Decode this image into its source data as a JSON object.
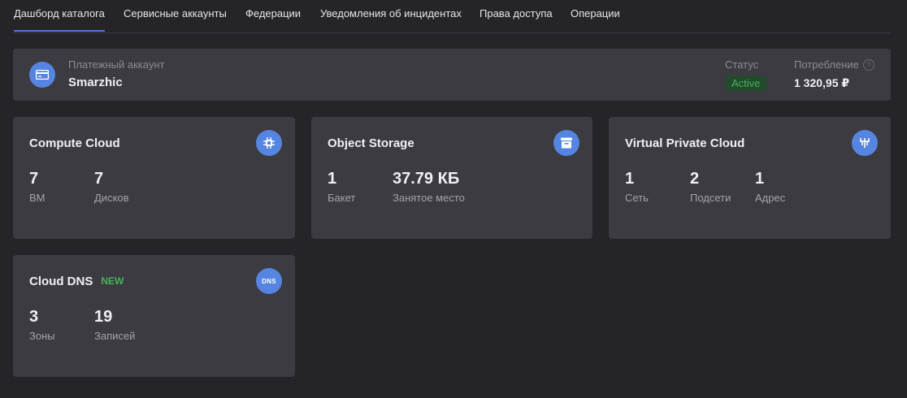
{
  "tabs": [
    "Дашборд каталога",
    "Сервисные аккаунты",
    "Федерации",
    "Уведомления об инцидентах",
    "Права доступа",
    "Операции"
  ],
  "billing": {
    "label": "Платежный аккаунт",
    "name": "Smarzhic",
    "status_label": "Статус",
    "status": "Active",
    "consumption_label": "Потребление",
    "consumption": "1 320,95 ₽",
    "help": "?",
    "icon": "credit-card-icon"
  },
  "cards": {
    "compute": {
      "title": "Compute Cloud",
      "icon": "chip-icon",
      "metrics": [
        {
          "value": "7",
          "label": "ВМ"
        },
        {
          "value": "7",
          "label": "Дисков"
        }
      ]
    },
    "storage": {
      "title": "Object Storage",
      "icon": "storage-bucket-icon",
      "metrics": [
        {
          "value": "1",
          "label": "Бакет"
        },
        {
          "value": "37.79 КБ",
          "label": "Занятое место"
        }
      ]
    },
    "vpc": {
      "title": "Virtual Private Cloud",
      "icon": "network-icon",
      "metrics": [
        {
          "value": "1",
          "label": "Сеть"
        },
        {
          "value": "2",
          "label": "Подсети"
        },
        {
          "value": "1",
          "label": "Адрес"
        }
      ]
    },
    "dns": {
      "title": "Cloud DNS",
      "badge": "NEW",
      "icon": "dns-icon",
      "icon_text": "DNS",
      "metrics": [
        {
          "value": "3",
          "label": "Зоны"
        },
        {
          "value": "19",
          "label": "Записей"
        }
      ]
    }
  },
  "colors": {
    "accent": "#5585e0",
    "active_tab": "#4c7bd9",
    "status_active": "#43b45a",
    "panel": "#3c3b42",
    "background": "#252429"
  }
}
